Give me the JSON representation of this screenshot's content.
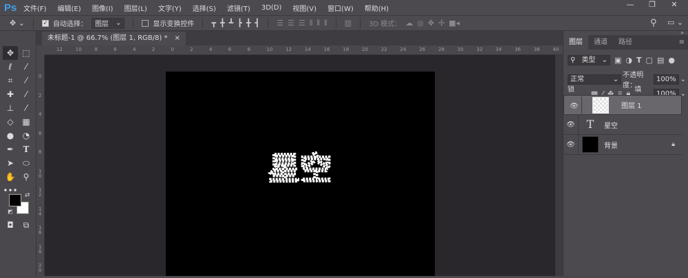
{
  "app": {
    "logo": "Ps"
  },
  "menu": [
    "文件(F)",
    "编辑(E)",
    "图像(I)",
    "图层(L)",
    "文字(Y)",
    "选择(S)",
    "滤镜(T)",
    "3D(D)",
    "视图(V)",
    "窗口(W)",
    "帮助(H)"
  ],
  "window_controls": {
    "minimize": "—",
    "restore": "❐",
    "close": "✕"
  },
  "options": {
    "auto_select_label": "自动选择：",
    "auto_select_checked": true,
    "auto_select_value": "图层",
    "show_transform_label": "显示变换控件",
    "show_transform_checked": false,
    "mode_3d_label": "3D 模式："
  },
  "document": {
    "tab_title": "未标题-1 @ 66.7% (图层 1, RGB/8) *",
    "close": "×",
    "text": "星空"
  },
  "rulers": {
    "horizontal": [
      "12",
      "10",
      "8",
      "6",
      "4",
      "2",
      "0",
      "2",
      "4",
      "6",
      "8",
      "10",
      "12",
      "14",
      "16",
      "18",
      "20",
      "22",
      "24",
      "26",
      "28",
      "30",
      "32",
      "34",
      "36",
      "38",
      "40"
    ],
    "vertical": [
      "0",
      "2",
      "4",
      "6",
      "8",
      "10",
      "12",
      "14",
      "16",
      "18",
      "20"
    ]
  },
  "layers_panel": {
    "tabs": [
      "图层",
      "通道",
      "路径"
    ],
    "filter_label": "类型",
    "blend_mode": "正常",
    "opacity_label": "不透明度：",
    "opacity": "100%",
    "lock_label": "锁定：",
    "fill_label": "填充：",
    "fill": "100%",
    "layers": [
      {
        "name": "图层 1",
        "selected": true
      },
      {
        "name": "星空",
        "type": "text"
      },
      {
        "name": "背景",
        "locked": true
      }
    ]
  }
}
